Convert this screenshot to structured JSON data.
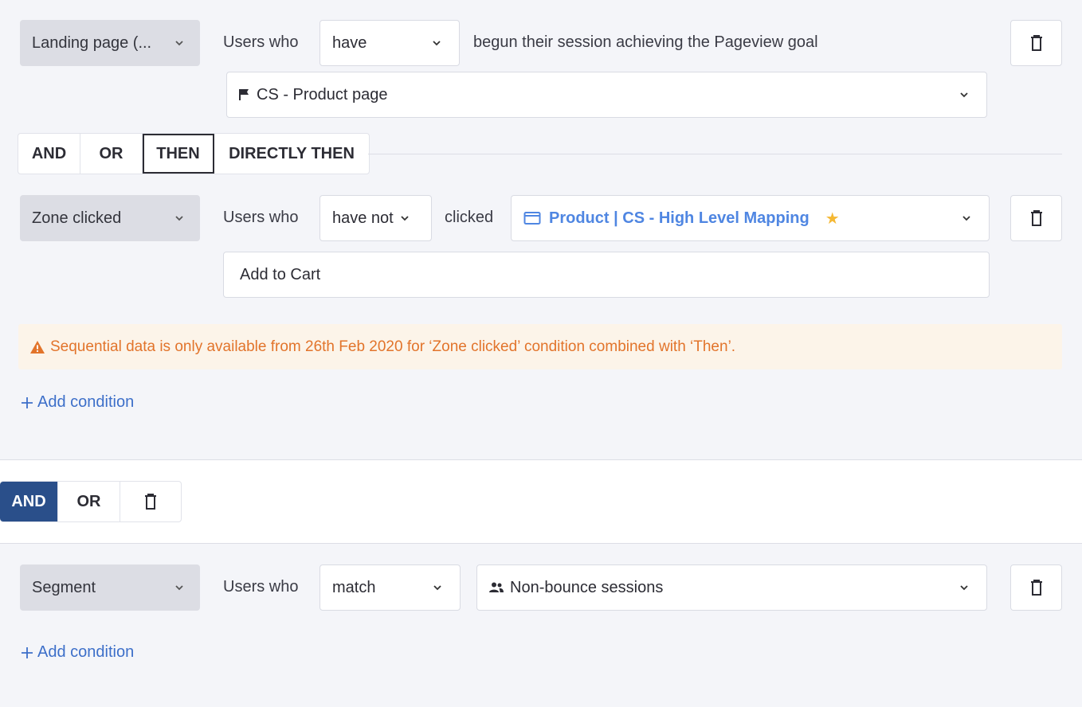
{
  "group1": {
    "condition1": {
      "type_label": "Landing page (...",
      "users_who": "Users who",
      "verb_select": "have",
      "description": "begun their session achieving the Pageview goal",
      "goal_select": "CS - Product page"
    },
    "operators": {
      "and": "AND",
      "or": "OR",
      "then": "THEN",
      "directly_then": "DIRECTLY THEN",
      "selected": "THEN"
    },
    "condition2": {
      "type_label": "Zone clicked",
      "users_who": "Users who",
      "verb_select": "have not",
      "clicked_label": "clicked",
      "mapping_select": "Product | CS - High Level Mapping",
      "zone_value": "Add to Cart"
    },
    "warning": "Sequential data is only available from 26th Feb 2020 for ‘Zone clicked’ condition combined with ‘Then’.",
    "add_condition": "Add condition"
  },
  "group_join": {
    "and": "AND",
    "or": "OR",
    "selected": "AND"
  },
  "group2": {
    "condition1": {
      "type_label": "Segment",
      "users_who": "Users who",
      "verb_select": "match",
      "segment_select": "Non-bounce sessions"
    },
    "add_condition": "Add condition"
  },
  "colors": {
    "accent": "#2a4f8a",
    "link": "#3d6fc9",
    "warning_text": "#e2742b",
    "warning_bg": "#fcf4e9",
    "star": "#f5b833"
  },
  "icons": [
    "chevron-down-icon",
    "trash-icon",
    "flag-icon",
    "window-icon",
    "star-icon",
    "warning-icon",
    "users-icon",
    "plus-icon"
  ]
}
